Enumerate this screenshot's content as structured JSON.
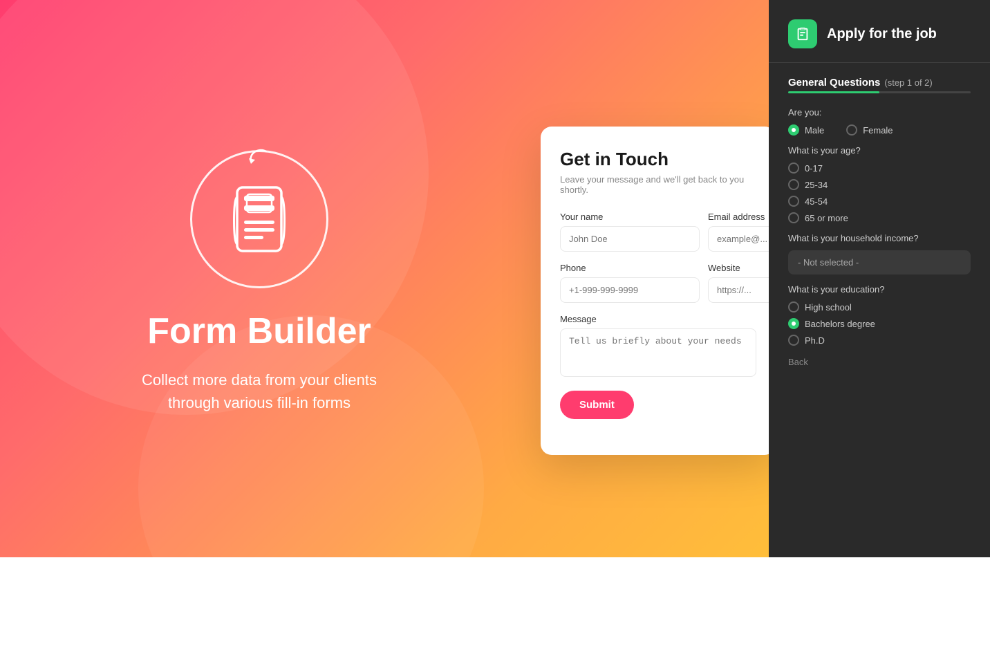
{
  "background": {
    "gradient_start": "#ff3c6e",
    "gradient_end": "#ffcc33"
  },
  "hero": {
    "title": "Form Builder",
    "subtitle_line1": "Collect more data from your clients",
    "subtitle_line2": "through various fill-in forms"
  },
  "contact_form": {
    "title": "Get in Touch",
    "subtitle": "Leave your message and we'll get back to you shortly.",
    "fields": {
      "your_name_label": "Your name",
      "your_name_placeholder": "John Doe",
      "email_label": "Email address",
      "email_placeholder": "example@...",
      "phone_label": "Phone",
      "phone_placeholder": "+1-999-999-9999",
      "website_label": "Website",
      "website_placeholder": "https://...",
      "message_label": "Message",
      "message_placeholder": "Tell us briefly about your needs"
    },
    "submit_label": "Submit"
  },
  "apply_panel": {
    "title": "Apply for the job",
    "section_title": "General Questions",
    "step_label": "(step 1 of 2)",
    "questions": {
      "gender": {
        "label": "Are you:",
        "options": [
          {
            "id": "male",
            "label": "Male",
            "selected": true
          },
          {
            "id": "female",
            "label": "Female",
            "selected": false
          }
        ]
      },
      "age": {
        "label": "What is your age?",
        "options": [
          {
            "id": "0-17",
            "label": "0-17",
            "selected": false
          },
          {
            "id": "25-34",
            "label": "25-34",
            "selected": false
          },
          {
            "id": "45-54",
            "label": "45-54",
            "selected": false
          },
          {
            "id": "65+",
            "label": "65 or more",
            "selected": false
          }
        ]
      },
      "income": {
        "label": "What is your household income?",
        "placeholder": "- Not selected -"
      },
      "education": {
        "label": "What is your education?",
        "options": [
          {
            "id": "high-school",
            "label": "High school",
            "selected": false
          },
          {
            "id": "bachelors",
            "label": "Bachelors degree",
            "selected": true
          },
          {
            "id": "phd",
            "label": "Ph.D",
            "selected": false
          }
        ]
      }
    },
    "back_label": "Back"
  }
}
